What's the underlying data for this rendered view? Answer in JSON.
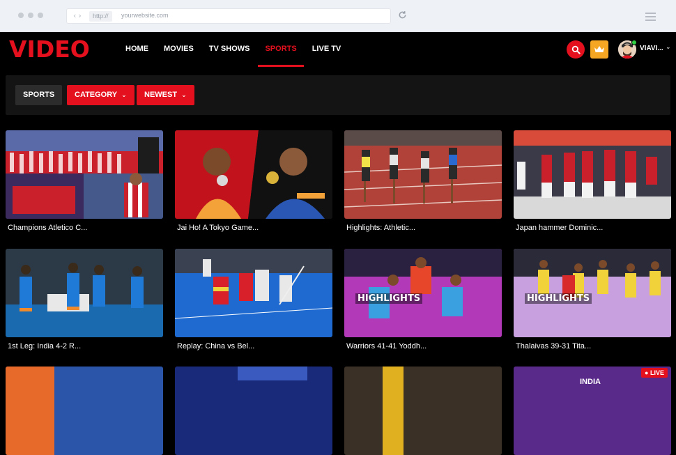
{
  "browser": {
    "http": "http://",
    "url": "yourwebsite.com"
  },
  "header": {
    "logo": "VIDEO",
    "menu": [
      {
        "label": "HOME",
        "active": false
      },
      {
        "label": "MOVIES",
        "active": false
      },
      {
        "label": "TV SHOWS",
        "active": false
      },
      {
        "label": "SPORTS",
        "active": true
      },
      {
        "label": "LIVE TV",
        "active": false
      }
    ],
    "username": "VIAVI...",
    "icons": [
      "search-icon",
      "crown-icon",
      "avatar"
    ]
  },
  "filters": {
    "section": "SPORTS",
    "category": "CATEGORY",
    "sort": "NEWEST"
  },
  "videos": [
    {
      "title": "Champions Atletico C...",
      "badge": ""
    },
    {
      "title": "Jai Ho! A Tokyo Game...",
      "badge": ""
    },
    {
      "title": "Highlights: Athletic...",
      "badge": ""
    },
    {
      "title": "Japan hammer Dominic...",
      "badge": ""
    },
    {
      "title": "1st Leg: India 4-2 R...",
      "badge": ""
    },
    {
      "title": "Replay: China vs Bel...",
      "badge": ""
    },
    {
      "title": "Warriors 41-41 Yoddh...",
      "badge": "HIGHLIGHTS"
    },
    {
      "title": "Thalaivas 39-31 Tita...",
      "badge": "HIGHLIGHTS"
    },
    {
      "title": "",
      "badge": ""
    },
    {
      "title": "",
      "badge": ""
    },
    {
      "title": "",
      "badge": ""
    },
    {
      "title": "",
      "badge": "LIVE"
    }
  ],
  "partial_row_text": "INDIA",
  "colors": {
    "brand_red": "#e4101e",
    "crown_gold": "#f5a623",
    "background": "#000000",
    "filter_bar": "#141414"
  }
}
